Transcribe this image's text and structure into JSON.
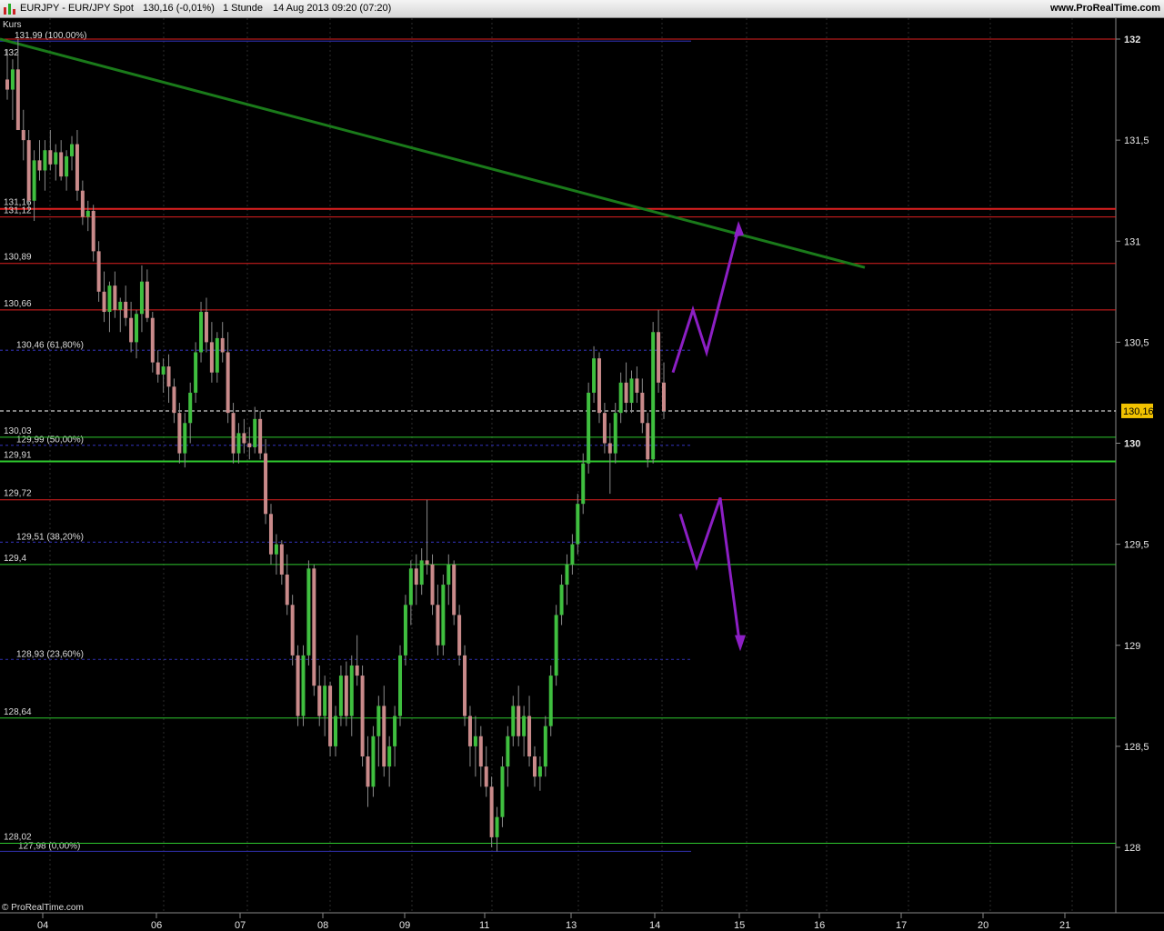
{
  "header": {
    "symbol": "EURJPY - EUR/JPY Spot",
    "last_change": "130,16 (-0,01%)",
    "timeframe": "1 Stunde",
    "datetime": "14 Aug 2013 09:20 (07:20)",
    "brand": "www.ProRealTime.com"
  },
  "pane_label": "Kurs",
  "footer": "© ProRealTime.com",
  "colors": {
    "background": "#000000",
    "up_candle": "#3fbf3f",
    "down_candle": "#c98a8a",
    "resistance_line": "#e02020",
    "support_line": "#2ec82e",
    "fib_line": "#2a2a9a",
    "trendline": "#1a7a1a",
    "projection_arrows": "#8c1fc4",
    "price_tag": "#f2c200"
  },
  "chart_data": {
    "type": "candlestick",
    "symbol": "EURJPY",
    "timeframe": "1h",
    "x_ticks": [
      "04",
      "06",
      "07",
      "08",
      "09",
      "11",
      "13",
      "14",
      "15",
      "16",
      "17",
      "20",
      "21"
    ],
    "y_ticks": [
      "132",
      "131,5",
      "131",
      "130,5",
      "130",
      "129,5",
      "129",
      "128,5",
      "128"
    ],
    "y_tick_values": [
      132,
      131.5,
      131,
      130.5,
      130,
      129.5,
      129,
      128.5,
      128
    ],
    "ylim": [
      127.7,
      132.2
    ],
    "last_price": 130.16,
    "last_price_label": "130,16",
    "horizontal_levels": [
      {
        "value": 131.16,
        "label": "131,16",
        "kind": "resistance",
        "bold": true
      },
      {
        "value": 131.12,
        "label": "131,12",
        "kind": "resistance"
      },
      {
        "value": 130.89,
        "label": "130,89",
        "kind": "resistance"
      },
      {
        "value": 130.66,
        "label": "130,66",
        "kind": "resistance"
      },
      {
        "value": 130.03,
        "label": "130,03",
        "kind": "support"
      },
      {
        "value": 129.91,
        "label": "129,91",
        "kind": "support",
        "bold": true
      },
      {
        "value": 129.72,
        "label": "129,72",
        "kind": "resistance"
      },
      {
        "value": 129.4,
        "label": "129,4",
        "kind": "support"
      },
      {
        "value": 128.64,
        "label": "128,64",
        "kind": "support"
      },
      {
        "value": 128.02,
        "label": "128,02",
        "kind": "support"
      },
      {
        "value": 132.0,
        "label": "132",
        "kind": "resistance"
      }
    ],
    "fibonacci_levels": [
      {
        "value": 131.99,
        "label": "131,99 (100,00%)"
      },
      {
        "value": 130.46,
        "label": "130,46 (61,80%)"
      },
      {
        "value": 129.99,
        "label": "129,99 (50,00%)"
      },
      {
        "value": 129.51,
        "label": "129,51 (38,20%)"
      },
      {
        "value": 128.93,
        "label": "128,93 (23,60%)"
      },
      {
        "value": 127.98,
        "label": "127,98 (0,00%)"
      }
    ],
    "trendline": {
      "from": {
        "day": "04",
        "value": 132.0
      },
      "to": {
        "day": "16",
        "value": 130.87
      }
    },
    "projections": [
      {
        "name": "bullish",
        "points": [
          [
            130.35
          ],
          [
            130.66
          ],
          [
            130.45
          ],
          [
            131.06
          ]
        ]
      },
      {
        "name": "bearish",
        "points": [
          [
            129.65
          ],
          [
            129.39
          ],
          [
            129.73
          ],
          [
            129.0
          ]
        ]
      }
    ],
    "candles": [
      {
        "o": 131.8,
        "h": 131.95,
        "l": 131.7,
        "c": 131.75
      },
      {
        "o": 131.75,
        "h": 131.9,
        "l": 131.6,
        "c": 131.85
      },
      {
        "o": 131.85,
        "h": 132.0,
        "l": 131.7,
        "c": 131.55
      },
      {
        "o": 131.55,
        "h": 131.65,
        "l": 131.4,
        "c": 131.5
      },
      {
        "o": 131.5,
        "h": 131.55,
        "l": 131.15,
        "c": 131.2
      },
      {
        "o": 131.2,
        "h": 131.45,
        "l": 131.1,
        "c": 131.4
      },
      {
        "o": 131.4,
        "h": 131.5,
        "l": 131.3,
        "c": 131.35
      },
      {
        "o": 131.35,
        "h": 131.5,
        "l": 131.25,
        "c": 131.45
      },
      {
        "o": 131.45,
        "h": 131.55,
        "l": 131.35,
        "c": 131.38
      },
      {
        "o": 131.38,
        "h": 131.48,
        "l": 131.3,
        "c": 131.44
      },
      {
        "o": 131.44,
        "h": 131.5,
        "l": 131.3,
        "c": 131.32
      },
      {
        "o": 131.32,
        "h": 131.45,
        "l": 131.25,
        "c": 131.42
      },
      {
        "o": 131.42,
        "h": 131.52,
        "l": 131.35,
        "c": 131.48
      },
      {
        "o": 131.48,
        "h": 131.55,
        "l": 131.2,
        "c": 131.25
      },
      {
        "o": 131.25,
        "h": 131.3,
        "l": 131.08,
        "c": 131.12
      },
      {
        "o": 131.12,
        "h": 131.2,
        "l": 131.05,
        "c": 131.15
      },
      {
        "o": 131.15,
        "h": 131.18,
        "l": 130.9,
        "c": 130.95
      },
      {
        "o": 130.95,
        "h": 131.0,
        "l": 130.7,
        "c": 130.75
      },
      {
        "o": 130.75,
        "h": 130.85,
        "l": 130.6,
        "c": 130.65
      },
      {
        "o": 130.65,
        "h": 130.8,
        "l": 130.55,
        "c": 130.78
      },
      {
        "o": 130.78,
        "h": 130.85,
        "l": 130.62,
        "c": 130.66
      },
      {
        "o": 130.66,
        "h": 130.72,
        "l": 130.55,
        "c": 130.7
      },
      {
        "o": 130.7,
        "h": 130.78,
        "l": 130.58,
        "c": 130.62
      },
      {
        "o": 130.62,
        "h": 130.7,
        "l": 130.45,
        "c": 130.5
      },
      {
        "o": 130.5,
        "h": 130.66,
        "l": 130.42,
        "c": 130.64
      },
      {
        "o": 130.64,
        "h": 130.88,
        "l": 130.55,
        "c": 130.8
      },
      {
        "o": 130.8,
        "h": 130.86,
        "l": 130.6,
        "c": 130.62
      },
      {
        "o": 130.62,
        "h": 130.65,
        "l": 130.35,
        "c": 130.4
      },
      {
        "o": 130.4,
        "h": 130.46,
        "l": 130.3,
        "c": 130.34
      },
      {
        "o": 130.34,
        "h": 130.42,
        "l": 130.25,
        "c": 130.38
      },
      {
        "o": 130.38,
        "h": 130.44,
        "l": 130.2,
        "c": 130.28
      },
      {
        "o": 130.28,
        "h": 130.32,
        "l": 130.1,
        "c": 130.15
      },
      {
        "o": 130.15,
        "h": 130.2,
        "l": 129.9,
        "c": 129.95
      },
      {
        "o": 129.95,
        "h": 130.15,
        "l": 129.88,
        "c": 130.1
      },
      {
        "o": 130.1,
        "h": 130.3,
        "l": 130.0,
        "c": 130.25
      },
      {
        "o": 130.25,
        "h": 130.5,
        "l": 130.2,
        "c": 130.45
      },
      {
        "o": 130.45,
        "h": 130.7,
        "l": 130.4,
        "c": 130.65
      },
      {
        "o": 130.65,
        "h": 130.72,
        "l": 130.45,
        "c": 130.5
      },
      {
        "o": 130.5,
        "h": 130.6,
        "l": 130.3,
        "c": 130.35
      },
      {
        "o": 130.35,
        "h": 130.55,
        "l": 130.3,
        "c": 130.52
      },
      {
        "o": 130.52,
        "h": 130.6,
        "l": 130.4,
        "c": 130.45
      },
      {
        "o": 130.45,
        "h": 130.55,
        "l": 130.1,
        "c": 130.15
      },
      {
        "o": 130.15,
        "h": 130.2,
        "l": 129.9,
        "c": 129.95
      },
      {
        "o": 129.95,
        "h": 130.1,
        "l": 129.9,
        "c": 130.05
      },
      {
        "o": 130.05,
        "h": 130.12,
        "l": 129.95,
        "c": 130.0
      },
      {
        "o": 130.0,
        "h": 130.08,
        "l": 129.92,
        "c": 129.98
      },
      {
        "o": 129.98,
        "h": 130.18,
        "l": 129.95,
        "c": 130.12
      },
      {
        "o": 130.12,
        "h": 130.16,
        "l": 129.92,
        "c": 129.95
      },
      {
        "o": 129.95,
        "h": 130.02,
        "l": 129.6,
        "c": 129.65
      },
      {
        "o": 129.65,
        "h": 129.7,
        "l": 129.4,
        "c": 129.45
      },
      {
        "o": 129.45,
        "h": 129.55,
        "l": 129.35,
        "c": 129.5
      },
      {
        "o": 129.5,
        "h": 129.52,
        "l": 129.3,
        "c": 129.35
      },
      {
        "o": 129.35,
        "h": 129.45,
        "l": 129.15,
        "c": 129.2
      },
      {
        "o": 129.2,
        "h": 129.25,
        "l": 128.9,
        "c": 128.95
      },
      {
        "o": 128.95,
        "h": 129.0,
        "l": 128.6,
        "c": 128.65
      },
      {
        "o": 128.65,
        "h": 129.0,
        "l": 128.6,
        "c": 128.95
      },
      {
        "o": 128.95,
        "h": 129.42,
        "l": 128.9,
        "c": 129.38
      },
      {
        "o": 129.38,
        "h": 129.4,
        "l": 128.75,
        "c": 128.8
      },
      {
        "o": 128.8,
        "h": 128.9,
        "l": 128.6,
        "c": 128.65
      },
      {
        "o": 128.65,
        "h": 128.85,
        "l": 128.55,
        "c": 128.8
      },
      {
        "o": 128.8,
        "h": 128.82,
        "l": 128.45,
        "c": 128.5
      },
      {
        "o": 128.5,
        "h": 128.7,
        "l": 128.45,
        "c": 128.65
      },
      {
        "o": 128.65,
        "h": 128.9,
        "l": 128.6,
        "c": 128.85
      },
      {
        "o": 128.85,
        "h": 128.92,
        "l": 128.6,
        "c": 128.65
      },
      {
        "o": 128.65,
        "h": 128.95,
        "l": 128.55,
        "c": 128.9
      },
      {
        "o": 128.9,
        "h": 129.05,
        "l": 128.8,
        "c": 128.85
      },
      {
        "o": 128.85,
        "h": 128.9,
        "l": 128.4,
        "c": 128.45
      },
      {
        "o": 128.45,
        "h": 128.55,
        "l": 128.2,
        "c": 128.3
      },
      {
        "o": 128.3,
        "h": 128.6,
        "l": 128.25,
        "c": 128.55
      },
      {
        "o": 128.55,
        "h": 128.75,
        "l": 128.4,
        "c": 128.7
      },
      {
        "o": 128.7,
        "h": 128.8,
        "l": 128.35,
        "c": 128.4
      },
      {
        "o": 128.4,
        "h": 128.55,
        "l": 128.3,
        "c": 128.5
      },
      {
        "o": 128.5,
        "h": 128.7,
        "l": 128.4,
        "c": 128.65
      },
      {
        "o": 128.65,
        "h": 129.0,
        "l": 128.6,
        "c": 128.95
      },
      {
        "o": 128.95,
        "h": 129.25,
        "l": 128.9,
        "c": 129.2
      },
      {
        "o": 129.2,
        "h": 129.42,
        "l": 129.1,
        "c": 129.38
      },
      {
        "o": 129.38,
        "h": 129.45,
        "l": 129.2,
        "c": 129.3
      },
      {
        "o": 129.3,
        "h": 129.48,
        "l": 129.25,
        "c": 129.42
      },
      {
        "o": 129.42,
        "h": 129.72,
        "l": 129.35,
        "c": 129.4
      },
      {
        "o": 129.4,
        "h": 129.45,
        "l": 129.15,
        "c": 129.2
      },
      {
        "o": 129.2,
        "h": 129.3,
        "l": 128.95,
        "c": 129.0
      },
      {
        "o": 129.0,
        "h": 129.35,
        "l": 128.95,
        "c": 129.3
      },
      {
        "o": 129.3,
        "h": 129.45,
        "l": 129.2,
        "c": 129.4
      },
      {
        "o": 129.4,
        "h": 129.42,
        "l": 129.1,
        "c": 129.15
      },
      {
        "o": 129.15,
        "h": 129.2,
        "l": 128.9,
        "c": 128.95
      },
      {
        "o": 128.95,
        "h": 129.0,
        "l": 128.6,
        "c": 128.65
      },
      {
        "o": 128.65,
        "h": 128.7,
        "l": 128.4,
        "c": 128.5
      },
      {
        "o": 128.5,
        "h": 128.65,
        "l": 128.35,
        "c": 128.55
      },
      {
        "o": 128.55,
        "h": 128.6,
        "l": 128.3,
        "c": 128.4
      },
      {
        "o": 128.4,
        "h": 128.5,
        "l": 128.25,
        "c": 128.3
      },
      {
        "o": 128.3,
        "h": 128.35,
        "l": 128.0,
        "c": 128.05
      },
      {
        "o": 128.05,
        "h": 128.2,
        "l": 127.98,
        "c": 128.15
      },
      {
        "o": 128.15,
        "h": 128.45,
        "l": 128.1,
        "c": 128.4
      },
      {
        "o": 128.4,
        "h": 128.6,
        "l": 128.3,
        "c": 128.55
      },
      {
        "o": 128.55,
        "h": 128.75,
        "l": 128.5,
        "c": 128.7
      },
      {
        "o": 128.7,
        "h": 128.8,
        "l": 128.5,
        "c": 128.55
      },
      {
        "o": 128.55,
        "h": 128.7,
        "l": 128.45,
        "c": 128.65
      },
      {
        "o": 128.65,
        "h": 128.75,
        "l": 128.4,
        "c": 128.45
      },
      {
        "o": 128.45,
        "h": 128.5,
        "l": 128.3,
        "c": 128.35
      },
      {
        "o": 128.35,
        "h": 128.45,
        "l": 128.28,
        "c": 128.4
      },
      {
        "o": 128.4,
        "h": 128.65,
        "l": 128.35,
        "c": 128.6
      },
      {
        "o": 128.6,
        "h": 128.9,
        "l": 128.55,
        "c": 128.85
      },
      {
        "o": 128.85,
        "h": 129.2,
        "l": 128.8,
        "c": 129.15
      },
      {
        "o": 129.15,
        "h": 129.35,
        "l": 129.1,
        "c": 129.3
      },
      {
        "o": 129.3,
        "h": 129.45,
        "l": 129.2,
        "c": 129.4
      },
      {
        "o": 129.4,
        "h": 129.55,
        "l": 129.35,
        "c": 129.5
      },
      {
        "o": 129.5,
        "h": 129.75,
        "l": 129.45,
        "c": 129.7
      },
      {
        "o": 129.7,
        "h": 129.95,
        "l": 129.65,
        "c": 129.9
      },
      {
        "o": 129.9,
        "h": 130.3,
        "l": 129.85,
        "c": 130.25
      },
      {
        "o": 130.25,
        "h": 130.48,
        "l": 130.2,
        "c": 130.42
      },
      {
        "o": 130.42,
        "h": 130.45,
        "l": 130.1,
        "c": 130.15
      },
      {
        "o": 130.15,
        "h": 130.2,
        "l": 129.95,
        "c": 130.0
      },
      {
        "o": 130.0,
        "h": 130.1,
        "l": 129.75,
        "c": 129.95
      },
      {
        "o": 129.95,
        "h": 130.2,
        "l": 129.9,
        "c": 130.15
      },
      {
        "o": 130.15,
        "h": 130.35,
        "l": 130.1,
        "c": 130.3
      },
      {
        "o": 130.3,
        "h": 130.4,
        "l": 130.15,
        "c": 130.2
      },
      {
        "o": 130.2,
        "h": 130.36,
        "l": 130.15,
        "c": 130.32
      },
      {
        "o": 130.32,
        "h": 130.38,
        "l": 130.2,
        "c": 130.25
      },
      {
        "o": 130.25,
        "h": 130.32,
        "l": 130.05,
        "c": 130.1
      },
      {
        "o": 130.1,
        "h": 130.15,
        "l": 129.88,
        "c": 129.92
      },
      {
        "o": 129.92,
        "h": 130.6,
        "l": 129.9,
        "c": 130.55
      },
      {
        "o": 130.55,
        "h": 130.66,
        "l": 130.25,
        "c": 130.3
      },
      {
        "o": 130.3,
        "h": 130.4,
        "l": 130.12,
        "c": 130.16
      }
    ]
  }
}
